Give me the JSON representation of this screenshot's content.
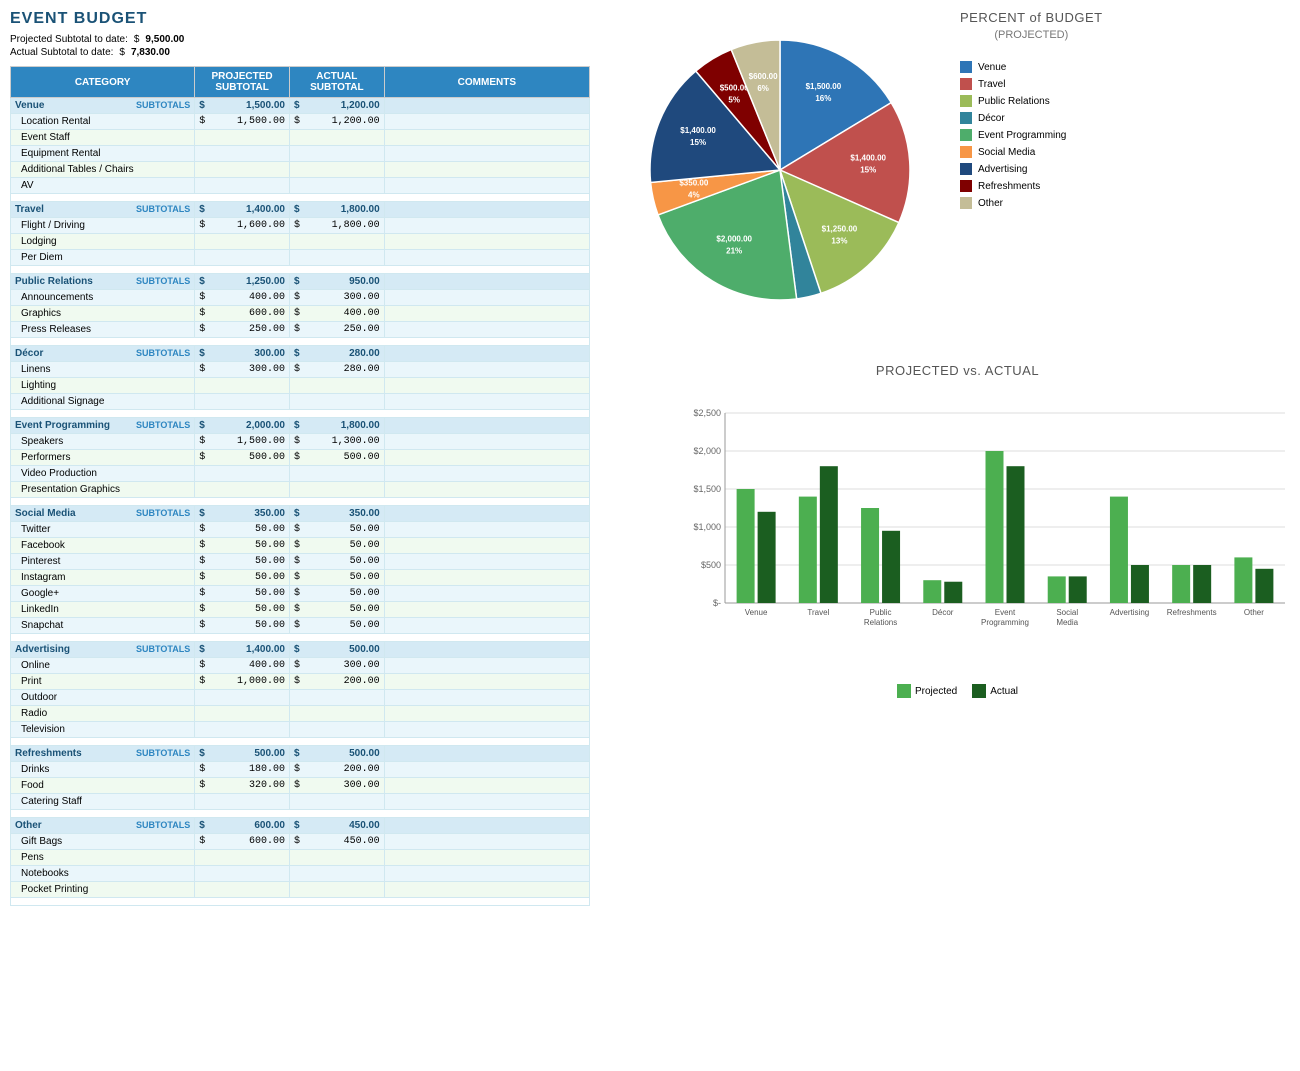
{
  "title": "EVENT BUDGET",
  "summary": {
    "projected_label": "Projected Subtotal to date:",
    "projected_dollar": "$",
    "projected_value": "9,500.00",
    "actual_label": "Actual Subtotal to date:",
    "actual_dollar": "$",
    "actual_value": "7,830.00"
  },
  "table": {
    "headers": [
      "CATEGORY",
      "PROJECTED SUBTOTAL",
      "ACTUAL SUBTOTAL",
      "COMMENTS"
    ],
    "categories": [
      {
        "name": "Venue",
        "projected": "1,500.00",
        "actual": "1,200.00",
        "items": [
          {
            "name": "Location Rental",
            "projected": "1,500.00",
            "actual": "1,200.00"
          },
          {
            "name": "Event Staff",
            "projected": "",
            "actual": ""
          },
          {
            "name": "Equipment Rental",
            "projected": "",
            "actual": ""
          },
          {
            "name": "Additional Tables / Chairs",
            "projected": "",
            "actual": ""
          },
          {
            "name": "AV",
            "projected": "",
            "actual": ""
          }
        ]
      },
      {
        "name": "Travel",
        "projected": "1,400.00",
        "actual": "1,800.00",
        "items": [
          {
            "name": "Flight / Driving",
            "projected": "1,600.00",
            "actual": "1,800.00"
          },
          {
            "name": "Lodging",
            "projected": "",
            "actual": ""
          },
          {
            "name": "Per Diem",
            "projected": "",
            "actual": ""
          }
        ]
      },
      {
        "name": "Public Relations",
        "projected": "1,250.00",
        "actual": "950.00",
        "items": [
          {
            "name": "Announcements",
            "projected": "400.00",
            "actual": "300.00"
          },
          {
            "name": "Graphics",
            "projected": "600.00",
            "actual": "400.00"
          },
          {
            "name": "Press Releases",
            "projected": "250.00",
            "actual": "250.00"
          }
        ]
      },
      {
        "name": "Décor",
        "projected": "300.00",
        "actual": "280.00",
        "items": [
          {
            "name": "Linens",
            "projected": "300.00",
            "actual": "280.00"
          },
          {
            "name": "Lighting",
            "projected": "",
            "actual": ""
          },
          {
            "name": "Additional Signage",
            "projected": "",
            "actual": ""
          }
        ]
      },
      {
        "name": "Event Programming",
        "projected": "2,000.00",
        "actual": "1,800.00",
        "items": [
          {
            "name": "Speakers",
            "projected": "1,500.00",
            "actual": "1,300.00"
          },
          {
            "name": "Performers",
            "projected": "500.00",
            "actual": "500.00"
          },
          {
            "name": "Video Production",
            "projected": "",
            "actual": ""
          },
          {
            "name": "Presentation Graphics",
            "projected": "",
            "actual": ""
          }
        ]
      },
      {
        "name": "Social Media",
        "projected": "350.00",
        "actual": "350.00",
        "items": [
          {
            "name": "Twitter",
            "projected": "50.00",
            "actual": "50.00"
          },
          {
            "name": "Facebook",
            "projected": "50.00",
            "actual": "50.00"
          },
          {
            "name": "Pinterest",
            "projected": "50.00",
            "actual": "50.00"
          },
          {
            "name": "Instagram",
            "projected": "50.00",
            "actual": "50.00"
          },
          {
            "name": "Google+",
            "projected": "50.00",
            "actual": "50.00"
          },
          {
            "name": "LinkedIn",
            "projected": "50.00",
            "actual": "50.00"
          },
          {
            "name": "Snapchat",
            "projected": "50.00",
            "actual": "50.00"
          }
        ]
      },
      {
        "name": "Advertising",
        "projected": "1,400.00",
        "actual": "500.00",
        "items": [
          {
            "name": "Online",
            "projected": "400.00",
            "actual": "300.00"
          },
          {
            "name": "Print",
            "projected": "1,000.00",
            "actual": "200.00"
          },
          {
            "name": "Outdoor",
            "projected": "",
            "actual": ""
          },
          {
            "name": "Radio",
            "projected": "",
            "actual": ""
          },
          {
            "name": "Television",
            "projected": "",
            "actual": ""
          }
        ]
      },
      {
        "name": "Refreshments",
        "projected": "500.00",
        "actual": "500.00",
        "items": [
          {
            "name": "Drinks",
            "projected": "180.00",
            "actual": "200.00"
          },
          {
            "name": "Food",
            "projected": "320.00",
            "actual": "300.00"
          },
          {
            "name": "Catering Staff",
            "projected": "",
            "actual": ""
          }
        ]
      },
      {
        "name": "Other",
        "projected": "600.00",
        "actual": "450.00",
        "items": [
          {
            "name": "Gift Bags",
            "projected": "600.00",
            "actual": "450.00"
          },
          {
            "name": "Pens",
            "projected": "",
            "actual": ""
          },
          {
            "name": "Notebooks",
            "projected": "",
            "actual": ""
          },
          {
            "name": "Pocket Printing",
            "projected": "",
            "actual": ""
          }
        ]
      }
    ]
  },
  "pie_chart": {
    "title": "PERCENT of BUDGET",
    "subtitle": "(PROJECTED)",
    "segments": [
      {
        "label": "Venue",
        "value": 16,
        "amount": "$1,500.00",
        "color": "#2e75b6"
      },
      {
        "label": "Travel",
        "value": 15,
        "amount": "$1,400.00",
        "color": "#c0504d"
      },
      {
        "label": "Public Relations",
        "value": 13,
        "amount": "$1,250.00",
        "color": "#9bbb59"
      },
      {
        "label": "Décor",
        "value": 3,
        "amount": "$300.00",
        "color": "#4bacc6"
      },
      {
        "label": "Event Programming",
        "value": 21,
        "amount": "$2,000.00",
        "color": "#4bacc6"
      },
      {
        "label": "Social Media",
        "value": 4,
        "amount": "$350.00",
        "color": "#f79646"
      },
      {
        "label": "Advertising",
        "value": 15,
        "amount": "$1,400.00",
        "color": "#1f497d"
      },
      {
        "label": "Refreshments",
        "value": 5,
        "amount": "$500.00",
        "color": "#7f0000"
      },
      {
        "label": "Other",
        "value": 6,
        "amount": "$600.00",
        "color": "#c4bd97"
      }
    ]
  },
  "bar_chart": {
    "title": "PROJECTED vs. ACTUAL",
    "y_labels": [
      "$2,500",
      "$2,000",
      "$1,500",
      "$1,000",
      "$500",
      "$-"
    ],
    "categories": [
      "Venue",
      "Travel",
      "Public Relations",
      "Décor",
      "Event Programming",
      "Social Media",
      "Advertising",
      "Refreshments",
      "Other"
    ],
    "projected": [
      1500,
      1400,
      1250,
      300,
      2000,
      350,
      1400,
      500,
      600
    ],
    "actual": [
      1200,
      1800,
      950,
      280,
      1800,
      350,
      500,
      500,
      450
    ],
    "legend": {
      "projected_label": "Projected",
      "actual_label": "Actual",
      "projected_color": "#4caf50",
      "actual_color": "#1b5e20"
    }
  }
}
